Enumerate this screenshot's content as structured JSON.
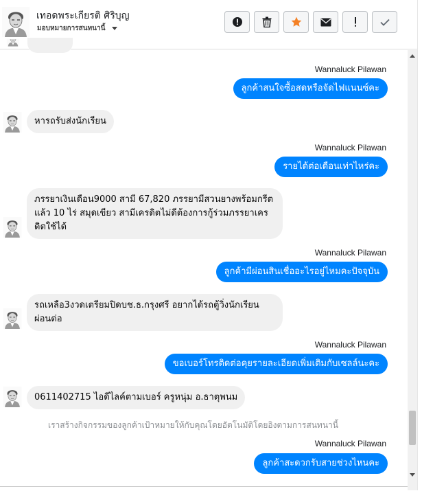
{
  "header": {
    "contact_name": "เทอดพระเกียรติ ศิริบุญ",
    "subtitle": "มอบหมายการสนทนานี้"
  },
  "toolbar": {
    "buttons": [
      {
        "icon": "alert-circle-icon"
      },
      {
        "icon": "trash-icon"
      },
      {
        "icon": "star-icon",
        "color": "#f48024"
      },
      {
        "icon": "envelope-icon"
      },
      {
        "icon": "exclamation-icon"
      },
      {
        "icon": "check-icon"
      }
    ]
  },
  "messages": [
    {
      "direction": "out",
      "sender": "Wannaluck Pilawan",
      "text": "ลูกค้าสนใจซื้อสดหรือจัดไฟแนนซ์คะ"
    },
    {
      "direction": "in",
      "lines": [
        "หารถรับส่งนักเรียน"
      ]
    },
    {
      "direction": "out",
      "sender": "Wannaluck Pilawan",
      "text": "รายได้ต่อเดือนเท่าไหร่คะ"
    },
    {
      "direction": "in",
      "lines": [
        "ภรรยาเงินเดือน9000 สามี 67,820 ภรรยามีสวนยางพร้อมกรีต",
        "แล้ว 10 ไร่ สมุดเขียว สามีเครดิตไม่ดีต้องการกู้ร่วมภรรยาเคร",
        "ดิตใช้ได้"
      ]
    },
    {
      "direction": "out",
      "sender": "Wannaluck Pilawan",
      "text": "ลูกค้ามีผ่อนสินเชื่ออะไรอยู่ไหมคะปัจจุบัน"
    },
    {
      "direction": "in",
      "lines": [
        "รถเหลือ3งวดเตรียมปิดบช.ธ.กรุงศรี อยากได้รถตู้วิ่งนักเรียน",
        "ผ่อนต่อ"
      ]
    },
    {
      "direction": "out",
      "sender": "Wannaluck Pilawan",
      "text": "ขอเบอร์โทรติดต่อคุยรายละเอียดเพิ่มเติมกับเซลล์นะคะ"
    },
    {
      "direction": "in",
      "lines": [
        "0611402715 ไอดีไลค์ตามเบอร์ ครูหนุ่ม อ.ธาตุพนม"
      ]
    },
    {
      "direction": "out",
      "sender": "Wannaluck Pilawan",
      "text": "ลูกค้าสะดวกรับสายช่วงไหนคะ"
    }
  ],
  "activity_note": "เราสร้างกิจกรรมของลูกค้าเป้าหมายให้กับคุณโดยอัตโนมัติโดยอิงตามการสนทนานี้",
  "colors": {
    "outgoing_bubble": "#0084ff",
    "incoming_bubble": "#f0f0f0",
    "star": "#f48024"
  }
}
